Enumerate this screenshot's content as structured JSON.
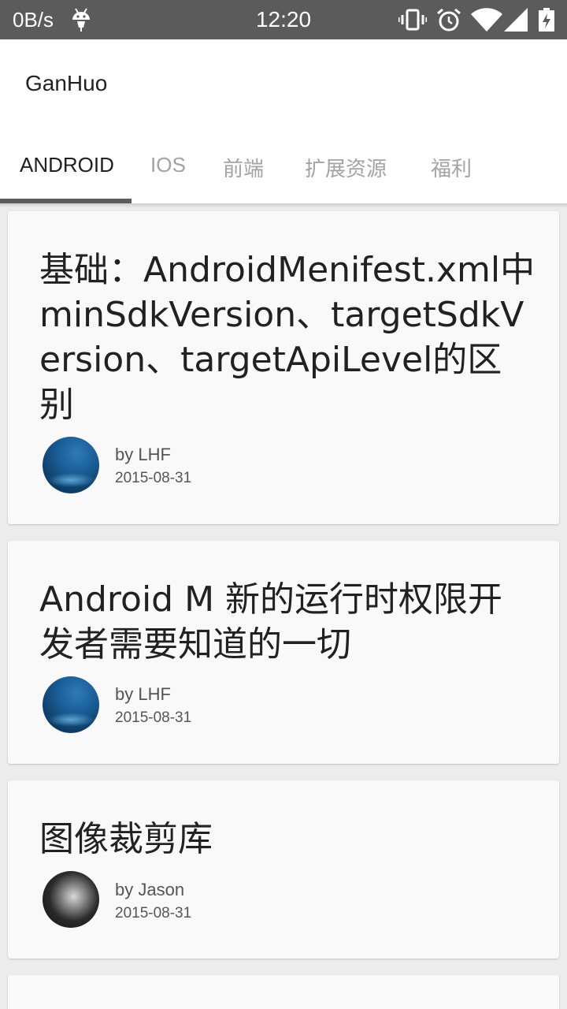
{
  "status_bar": {
    "net_speed": "0B/s",
    "time": "12:20",
    "icons": [
      "android-debug-icon",
      "vibrate-icon",
      "alarm-icon",
      "wifi-icon",
      "signal-icon",
      "battery-charging-icon"
    ]
  },
  "toolbar": {
    "title": "GanHuo"
  },
  "tabs": [
    {
      "label": "ANDROID",
      "active": true
    },
    {
      "label": "IOS",
      "active": false
    },
    {
      "label": "前端",
      "active": false
    },
    {
      "label": "扩展资源",
      "active": false
    },
    {
      "label": "福利",
      "active": false
    }
  ],
  "cards": [
    {
      "title": "基础：AndroidMenifest.xml中minSdkVersion、targetSdkVersion、targetApiLevel的区别",
      "author": "by LHF",
      "date": "2015-08-31",
      "avatar": "sky"
    },
    {
      "title": "Android M 新的运行时权限开发者需要知道的一切",
      "author": "by LHF",
      "date": "2015-08-31",
      "avatar": "sky"
    },
    {
      "title": "图像裁剪库",
      "author": "by Jason",
      "date": "2015-08-31",
      "avatar": "dark"
    }
  ],
  "colors": {
    "status_bar": "#5b5b5b",
    "background": "#ececec",
    "card": "#f9f9f9",
    "tab_active": "#212121",
    "tab_inactive": "#a3a3a3"
  }
}
